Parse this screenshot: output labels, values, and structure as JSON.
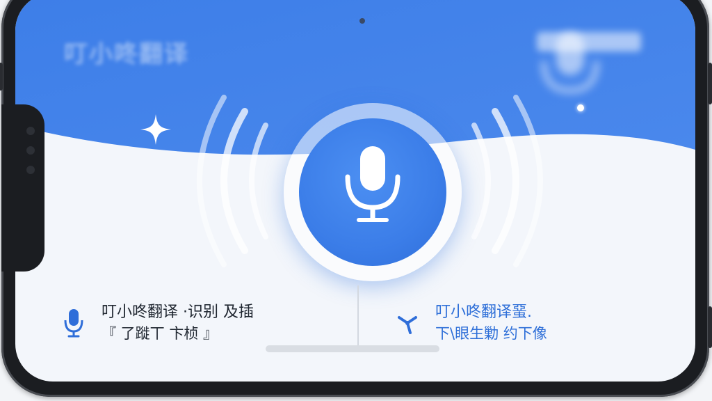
{
  "header": {
    "title": "叮小咚翻译"
  },
  "mic_button": {
    "icon": "microphone-icon"
  },
  "cards": {
    "voice": {
      "icon": "microphone-icon",
      "line1": "叮小咚翻译 ·识别 及插",
      "line2": "『 了蹝丅 卞桢 』"
    },
    "translate": {
      "icon": "branch-share-icon",
      "line1": "叮小咚翻译蝁.",
      "line2": "下\\眼生勦 约下像"
    }
  },
  "colors": {
    "primary_blue": "#3b7de8",
    "header_blue": "#3f7fe6",
    "background": "#f3f6fb",
    "accent_text": "#2e6fd8"
  }
}
